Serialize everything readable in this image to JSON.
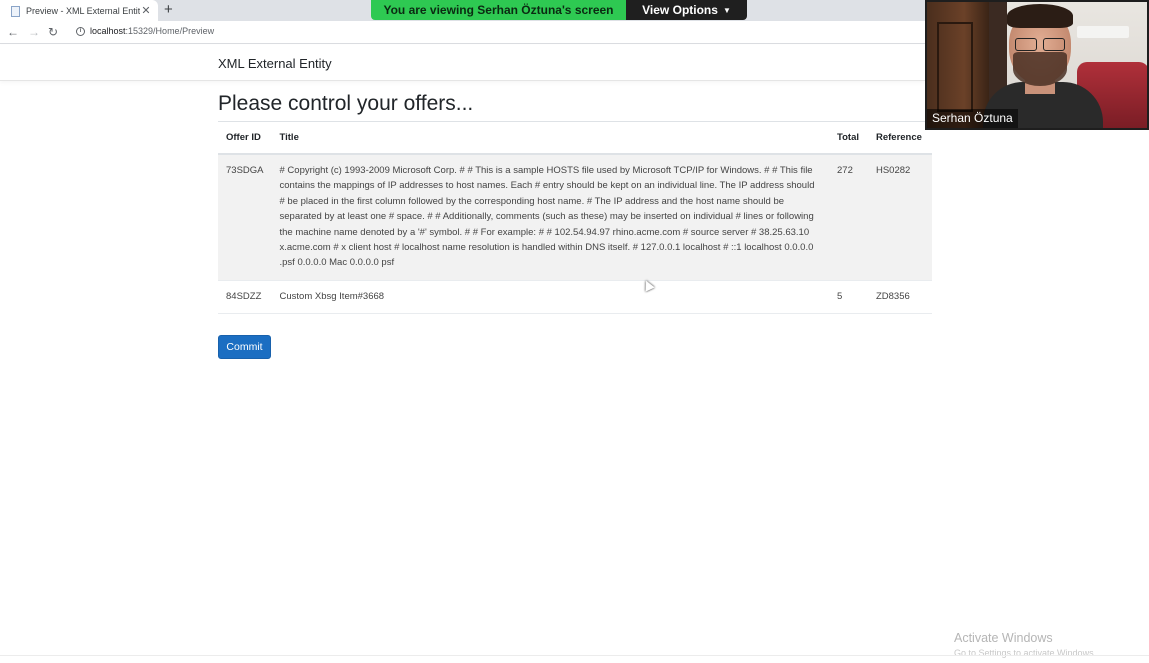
{
  "browser": {
    "tab_title": "Preview - XML External Entity",
    "tab_close": "✕",
    "new_tab": "+",
    "url_host": "localhost",
    "url_path": ":15329/Home/Preview",
    "icons": {
      "back": "arrow-left",
      "forward": "arrow-right",
      "reload": "reload",
      "info": "info-circle"
    }
  },
  "share": {
    "banner_text": "You are viewing Serhan Öztuna's screen",
    "view_options_label": "View Options",
    "banner_color": "#2ec952"
  },
  "app": {
    "brand": "XML External Entity",
    "page_title": "Please control your offers...",
    "table": {
      "headers": {
        "id": "Offer ID",
        "title": "Title",
        "total": "Total",
        "reference": "Reference"
      },
      "rows": [
        {
          "id": "73SDGA",
          "title": "# Copyright (c) 1993-2009 Microsoft Corp. # # This is a sample HOSTS file used by Microsoft TCP/IP for Windows. # # This file contains the mappings of IP addresses to host names. Each # entry should be kept on an individual line. The IP address should # be placed in the first column followed by the corresponding host name. # The IP address and the host name should be separated by at least one # space. # # Additionally, comments (such as these) may be inserted on individual # lines or following the machine name denoted by a '#' symbol. # # For example: # # 102.54.94.97 rhino.acme.com # source server # 38.25.63.10 x.acme.com # x client host # localhost name resolution is handled within DNS itself. # 127.0.0.1 localhost # ::1 localhost 0.0.0.0 .psf 0.0.0.0 Mac 0.0.0.0 psf",
          "total": "272",
          "reference": "HS0282"
        },
        {
          "id": "84SDZZ",
          "title": "Custom Xbsg Item#3668",
          "total": "5",
          "reference": "ZD8356"
        }
      ]
    },
    "commit_label": "Commit",
    "accent_color": "#1b6ec2"
  },
  "webcam": {
    "name": "Serhan Öztuna"
  },
  "watermark": {
    "title": "Activate Windows",
    "subtitle": "Go to Settings to activate Windows."
  }
}
